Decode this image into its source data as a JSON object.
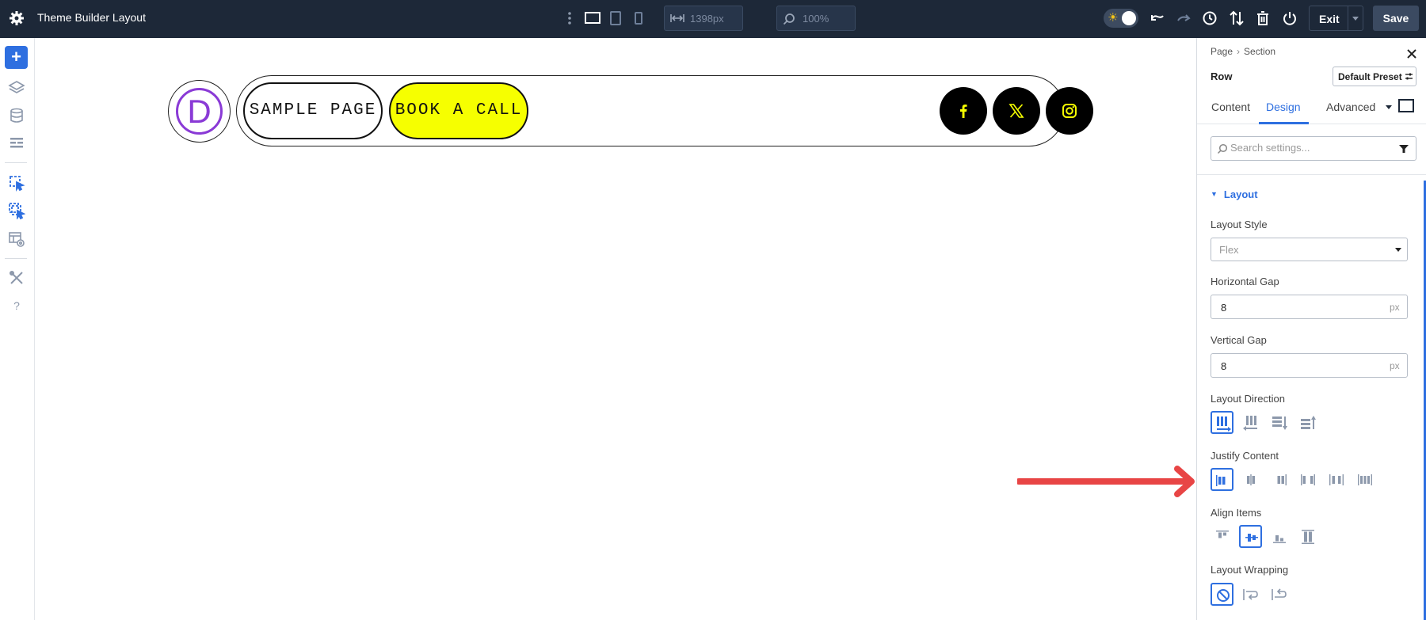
{
  "topbar": {
    "title": "Theme Builder Layout",
    "width_value": "1398px",
    "zoom_value": "100%",
    "exit_label": "Exit",
    "save_label": "Save"
  },
  "canvas": {
    "logo_letter": "D",
    "nav_buttons": [
      "SAMPLE PAGE",
      "BOOK A CALL"
    ],
    "social_icons": [
      "facebook-icon",
      "x-twitter-icon",
      "instagram-icon"
    ]
  },
  "panel": {
    "breadcrumb": [
      "Page",
      "Section"
    ],
    "element_title": "Row",
    "preset_label": "Default Preset",
    "tabs": [
      "Content",
      "Design",
      "Advanced"
    ],
    "active_tab": "Design",
    "search_placeholder": "Search settings...",
    "section_title": "Layout",
    "layout_style": {
      "label": "Layout Style",
      "value": "Flex"
    },
    "horizontal_gap": {
      "label": "Horizontal Gap",
      "value": "8",
      "unit": "px"
    },
    "vertical_gap": {
      "label": "Vertical Gap",
      "value": "8",
      "unit": "px"
    },
    "layout_direction": {
      "label": "Layout Direction",
      "options": [
        "row",
        "row-reverse",
        "column",
        "column-reverse"
      ],
      "selected": "row"
    },
    "justify_content": {
      "label": "Justify Content",
      "options": [
        "start",
        "center",
        "end",
        "space-between",
        "space-around",
        "space-evenly"
      ],
      "selected": "start"
    },
    "align_items": {
      "label": "Align Items",
      "options": [
        "start",
        "center",
        "end",
        "stretch"
      ],
      "selected": "center"
    },
    "layout_wrapping": {
      "label": "Layout Wrapping",
      "options": [
        "nowrap",
        "wrap",
        "wrap-reverse"
      ],
      "selected": "nowrap"
    }
  },
  "colors": {
    "accent": "#2e6fe0",
    "topbar_bg": "#1d2838",
    "cta_yellow": "#f6ff00",
    "logo_purple": "#8a3ad6",
    "annotation_arrow": "#e84545"
  }
}
